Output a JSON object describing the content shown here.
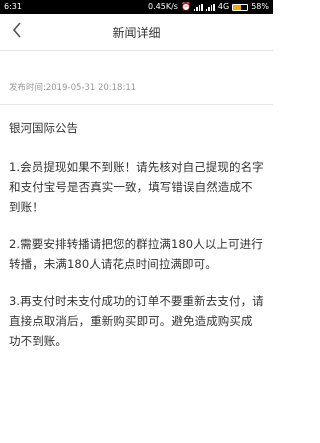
{
  "status_bar": {
    "time": "6:31",
    "network_speed": "0.45K/s",
    "network_type": "4G",
    "battery_percent": "58%",
    "battery_level": 0.58,
    "battery_color": "#f2a900"
  },
  "nav": {
    "back_icon": "chevron-left-icon",
    "title": "新闻详细"
  },
  "article": {
    "publish_time": "发布时间:2019-05-31 20:18:11",
    "notice_title": "银河国际公告",
    "paragraphs": [
      "1.会员提现如果不到账！请先核对自己提现的名字和支付宝号是否真实一致，填写错误自然造成不到账！",
      "2.需要安排转播请把您的群拉满180人以上可进行转播，未满180人请花点时间拉满即可。",
      "3.再支付时未支付成功的订单不要重新去支付，请直接点取消后，重新购买即可。避免造成购买成功不到账。"
    ]
  }
}
